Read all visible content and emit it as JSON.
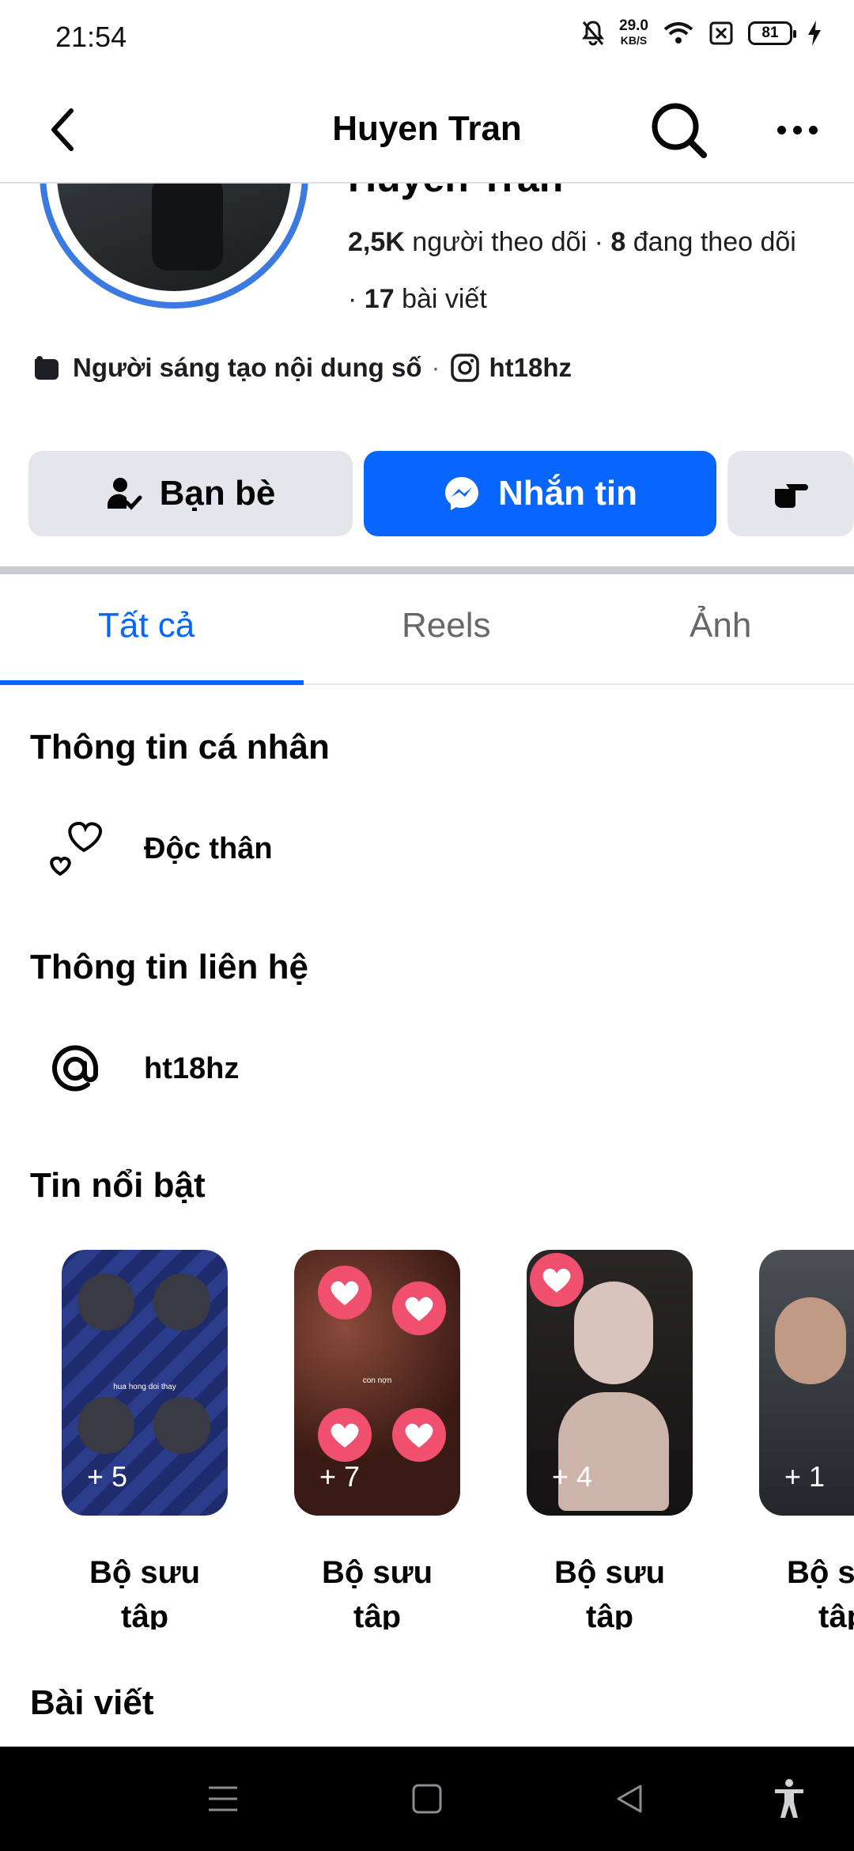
{
  "status_bar": {
    "time": "21:54",
    "net_speed_value": "29.0",
    "net_speed_unit": "KB/S",
    "battery": "81",
    "icons": [
      "bell-off-icon",
      "wifi-icon",
      "sim-off-icon",
      "battery-icon",
      "charging-icon"
    ]
  },
  "header": {
    "title": "Huyen Tran",
    "back_icon": "back-arrow-icon",
    "search_icon": "search-icon",
    "more_icon": "more-icon"
  },
  "profile": {
    "name_partial": "Huyen Tran",
    "followers_count": "2,5K",
    "followers_label": "người theo dõi",
    "following_count": "8",
    "following_label": "đang theo dõi",
    "posts_count": "17",
    "posts_label": "bài viết",
    "creator_label": "Người sáng tạo nội dung số",
    "instagram_handle": "ht18hz"
  },
  "actions": {
    "friends_label": "Bạn bè",
    "message_label": "Nhắn tin"
  },
  "tabs": [
    {
      "label": "Tất cả",
      "active": true
    },
    {
      "label": "Reels",
      "active": false
    },
    {
      "label": "Ảnh",
      "active": false
    }
  ],
  "personal_info": {
    "title": "Thông tin cá nhân",
    "relationship": "Độc thân"
  },
  "contact_info": {
    "title": "Thông tin liên hệ",
    "handle": "ht18hz"
  },
  "highlights": {
    "title": "Tin nổi bật",
    "items": [
      {
        "count": "+ 5",
        "label_line1": "Bộ sưu",
        "label_line2": "tập",
        "caption": "hua hong doi thay"
      },
      {
        "count": "+ 7",
        "label_line1": "Bộ sưu",
        "label_line2": "tập",
        "caption": "con nợn"
      },
      {
        "count": "+ 4",
        "label_line1": "Bộ sưu",
        "label_line2": "tập"
      },
      {
        "count": "+ 1",
        "label_line1": "Bộ sưu",
        "label_line2": "tập"
      }
    ]
  },
  "posts": {
    "title": "Bài viết"
  },
  "colors": {
    "accent": "#0866ff",
    "avatar_ring": "#3b7ae0",
    "secondary_text": "#65676b",
    "button_gray": "#e4e6eb"
  }
}
